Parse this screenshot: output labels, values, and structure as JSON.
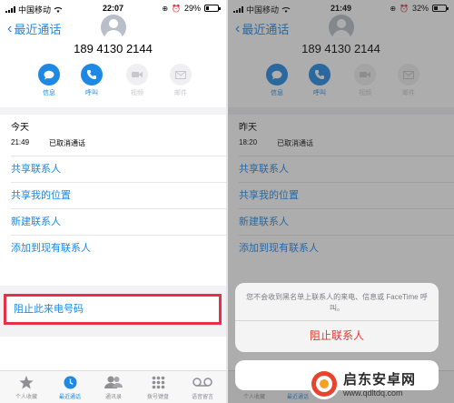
{
  "left": {
    "status": {
      "carrier": "中国移动",
      "time": "22:07",
      "battery_text": "29%",
      "battery_level": 0.29
    },
    "back_label": "最近通话",
    "phone_number": "189 4130 2144",
    "actions": {
      "message": "信息",
      "call": "呼叫",
      "video": "视频",
      "mail": "邮件"
    },
    "call_day": "今天",
    "call_time": "21:49",
    "call_status": "已取消通话",
    "menu": [
      "共享联系人",
      "共享我的位置",
      "新建联系人",
      "添加到现有联系人"
    ],
    "block_label": "阻止此来电号码",
    "tabs": [
      "个人收藏",
      "最近通话",
      "通讯录",
      "拨号键盘",
      "语音留言"
    ]
  },
  "right": {
    "status": {
      "carrier": "中国移动",
      "time": "21:49",
      "battery_text": "32%",
      "battery_level": 0.32
    },
    "back_label": "最近通话",
    "phone_number": "189 4130 2144",
    "actions": {
      "message": "信息",
      "call": "呼叫",
      "video": "视频",
      "mail": "邮件"
    },
    "call_day": "昨天",
    "call_time": "18:20",
    "call_status": "已取消通话",
    "menu": [
      "共享联系人",
      "共享我的位置",
      "新建联系人",
      "添加到现有联系人"
    ],
    "sheet_message": "您不会收到黑名单上联系人的来电、信息或 FaceTime 呼叫。",
    "sheet_block": "阻止联系人",
    "tabs_visible": [
      "个人收藏",
      "最近通话"
    ]
  },
  "watermark": {
    "name": "启东安卓网",
    "url": "www.qdltdq.com"
  },
  "colors": {
    "accent": "#1e88e5",
    "highlight_border": "#e8304a",
    "destructive": "#e5372f"
  }
}
